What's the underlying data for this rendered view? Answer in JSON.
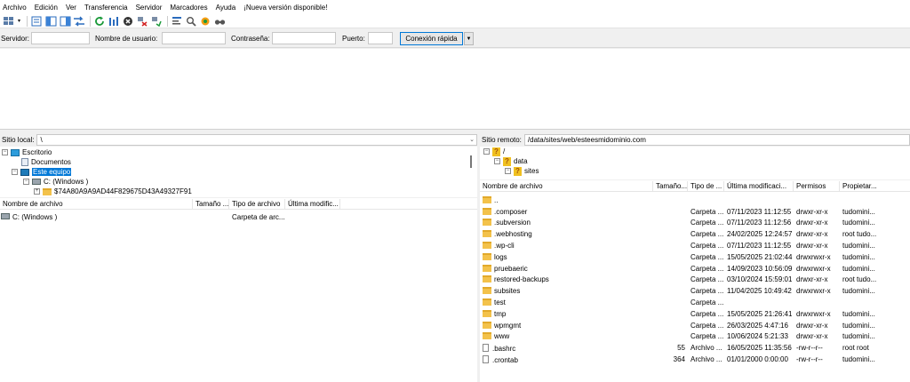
{
  "menu": [
    "Archivo",
    "Edición",
    "Ver",
    "Transferencia",
    "Servidor",
    "Marcadores",
    "Ayuda",
    "¡Nueva versión disponible!"
  ],
  "toolbar_icons": [
    "site-manager-icon",
    "dropdown-arrow-icon",
    "toggle-log-icon",
    "toggle-local-tree-icon",
    "toggle-remote-tree-icon",
    "toggle-queue-icon",
    "refresh-icon",
    "process-queue-icon",
    "cancel-icon",
    "disconnect-icon",
    "reconnect-icon",
    "filter-icon",
    "search-files-icon",
    "sync-browsing-icon",
    "compare-icon"
  ],
  "quickconnect": {
    "host_label": "Servidor:",
    "user_label": "Nombre de usuario:",
    "pass_label": "Contraseña:",
    "port_label": "Puerto:",
    "connect_button": "Conexión rápida",
    "host_value": "",
    "user_value": "",
    "pass_value": "",
    "port_value": ""
  },
  "local": {
    "site_label": "Sitio local:",
    "path": "\\",
    "tree": [
      {
        "label": "Escritorio",
        "icon": "desktop-icon",
        "exp": "−"
      },
      {
        "label": "Documentos",
        "icon": "documents-icon",
        "exp": ""
      },
      {
        "label": "Este equipo",
        "icon": "computer-icon",
        "exp": "−",
        "selected": true
      },
      {
        "label": "C: (Windows )",
        "icon": "drive-icon",
        "exp": "−"
      },
      {
        "label": "$74A80A9A9AD44F829675D43A49327F91",
        "icon": "folder-icon",
        "exp": "+"
      }
    ],
    "columns": [
      "Nombre de archivo",
      "Tamaño ...",
      "Tipo de archivo",
      "Última modific..."
    ],
    "files": [
      {
        "name": "C: (Windows )",
        "size": "",
        "type": "Carpeta de arc...",
        "modified": ""
      }
    ]
  },
  "remote": {
    "site_label": "Sitio remoto:",
    "path": "/data/sites/web/esteesmidominio.com",
    "tree": [
      {
        "label": "/",
        "exp": "−"
      },
      {
        "label": "data",
        "exp": "−"
      },
      {
        "label": "sites",
        "exp": "−"
      }
    ],
    "columns": [
      "Nombre de archivo",
      "Tamaño...",
      "Tipo de ...",
      "Última modificaci...",
      "Permisos",
      "Propietar..."
    ],
    "files": [
      {
        "name": "..",
        "size": "",
        "type": "",
        "modified": "",
        "perms": "",
        "owner": "",
        "kind": "folder"
      },
      {
        "name": ".composer",
        "size": "",
        "type": "Carpeta ...",
        "modified": "07/11/2023 11:12:55",
        "perms": "drwxr-xr-x",
        "owner": "tudomini...",
        "kind": "folder"
      },
      {
        "name": ".subversion",
        "size": "",
        "type": "Carpeta ...",
        "modified": "07/11/2023 11:12:56",
        "perms": "drwxr-xr-x",
        "owner": "tudomini...",
        "kind": "folder"
      },
      {
        "name": ".webhosting",
        "size": "",
        "type": "Carpeta ...",
        "modified": "24/02/2025 12:24:57",
        "perms": "drwxr-xr-x",
        "owner": "root tudo...",
        "kind": "folder"
      },
      {
        "name": ".wp-cli",
        "size": "",
        "type": "Carpeta ...",
        "modified": "07/11/2023 11:12:55",
        "perms": "drwxr-xr-x",
        "owner": "tudomini...",
        "kind": "folder"
      },
      {
        "name": "logs",
        "size": "",
        "type": "Carpeta ...",
        "modified": "15/05/2025 21:02:44",
        "perms": "drwxrwxr-x",
        "owner": "tudomini...",
        "kind": "folder"
      },
      {
        "name": "pruebaeric",
        "size": "",
        "type": "Carpeta ...",
        "modified": "14/09/2023 10:56:09",
        "perms": "drwxrwxr-x",
        "owner": "tudomini...",
        "kind": "folder"
      },
      {
        "name": "restored-backups",
        "size": "",
        "type": "Carpeta ...",
        "modified": "03/10/2024 15:59:01",
        "perms": "drwxr-xr-x",
        "owner": "root tudo...",
        "kind": "folder"
      },
      {
        "name": "subsites",
        "size": "",
        "type": "Carpeta ...",
        "modified": "11/04/2025 10:49:42",
        "perms": "drwxrwxr-x",
        "owner": "tudomini...",
        "kind": "folder"
      },
      {
        "name": "test",
        "size": "",
        "type": "Carpeta ...",
        "modified": "",
        "perms": "",
        "owner": "",
        "kind": "folder"
      },
      {
        "name": "tmp",
        "size": "",
        "type": "Carpeta ...",
        "modified": "15/05/2025 21:26:41",
        "perms": "drwxrwxr-x",
        "owner": "tudomini...",
        "kind": "folder"
      },
      {
        "name": "wpmgmt",
        "size": "",
        "type": "Carpeta ...",
        "modified": "26/03/2025 4:47:16",
        "perms": "drwxr-xr-x",
        "owner": "tudomini...",
        "kind": "folder"
      },
      {
        "name": "www",
        "size": "",
        "type": "Carpeta ...",
        "modified": "10/06/2024 5:21:33",
        "perms": "drwxr-xr-x",
        "owner": "tudomini...",
        "kind": "folder"
      },
      {
        "name": ".bashrc",
        "size": "55",
        "type": "Archivo ...",
        "modified": "16/05/2025 11:35:56",
        "perms": "-rw-r--r--",
        "owner": "root root",
        "kind": "file"
      },
      {
        "name": ".crontab",
        "size": "364",
        "type": "Archivo ...",
        "modified": "01/01/2000 0:00:00",
        "perms": "-rw-r--r--",
        "owner": "tudomini...",
        "kind": "file"
      }
    ]
  }
}
